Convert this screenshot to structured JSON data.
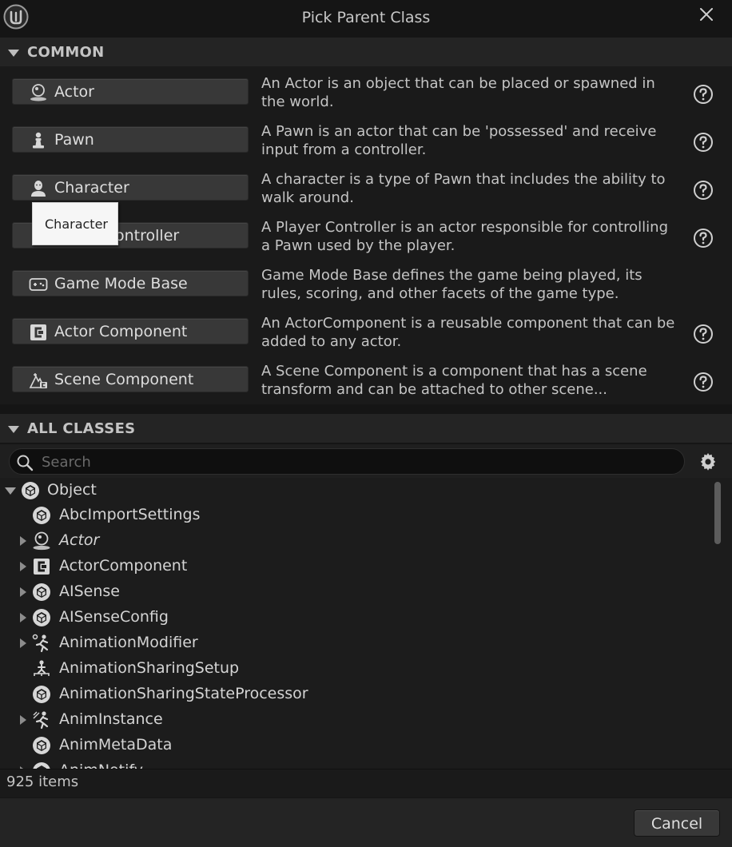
{
  "window": {
    "title": "Pick Parent Class"
  },
  "common": {
    "header": "COMMON",
    "rows": [
      {
        "label": "Actor",
        "icon": "actor-icon",
        "description": "An Actor is an object that can be placed or spawned in the world.",
        "has_help": true
      },
      {
        "label": "Pawn",
        "icon": "pawn-icon",
        "description": "A Pawn is an actor that can be 'possessed' and receive input from a controller.",
        "has_help": true
      },
      {
        "label": "Character",
        "icon": "character-icon",
        "description": "A character is a type of Pawn that includes the ability to walk around.",
        "has_help": true
      },
      {
        "label": "Player Controller",
        "visible_label": "ontroller",
        "icon": "player-controller-icon",
        "description": "A Player Controller is an actor responsible for controlling a Pawn used by the player.",
        "has_help": true
      },
      {
        "label": "Game Mode Base",
        "icon": "gamepad-icon",
        "description": "Game Mode Base defines the game being played, its rules, scoring, and other facets of the game type.",
        "has_help": false
      },
      {
        "label": "Actor Component",
        "icon": "component-icon",
        "description": "An ActorComponent is a reusable component that can be added to any actor.",
        "has_help": true
      },
      {
        "label": "Scene Component",
        "icon": "scene-component-icon",
        "description": "A Scene Component is a component that has a scene transform and can be attached to other scene...",
        "has_help": true
      }
    ],
    "tooltip": "Character"
  },
  "all_classes": {
    "header": "ALL CLASSES",
    "search_placeholder": "Search",
    "tree": [
      {
        "label": "Object",
        "icon": "object-icon",
        "expander": "open",
        "italic": false
      },
      {
        "label": "AbcImportSettings",
        "icon": "object-icon",
        "expander": "none",
        "italic": false
      },
      {
        "label": "Actor",
        "icon": "actor-icon",
        "expander": "closed",
        "italic": true
      },
      {
        "label": "ActorComponent",
        "icon": "component-icon",
        "expander": "closed",
        "italic": false
      },
      {
        "label": "AISense",
        "icon": "object-icon",
        "expander": "closed",
        "italic": false
      },
      {
        "label": "AISenseConfig",
        "icon": "object-icon",
        "expander": "closed",
        "italic": false
      },
      {
        "label": "AnimationModifier",
        "icon": "animation-modifier-icon",
        "expander": "closed",
        "italic": false
      },
      {
        "label": "AnimationSharingSetup",
        "icon": "animation-sharing-icon",
        "expander": "none",
        "italic": false
      },
      {
        "label": "AnimationSharingStateProcessor",
        "icon": "object-icon",
        "expander": "none",
        "italic": false
      },
      {
        "label": "AnimInstance",
        "icon": "anim-instance-icon",
        "expander": "closed",
        "italic": false
      },
      {
        "label": "AnimMetaData",
        "icon": "object-icon",
        "expander": "none",
        "italic": false
      },
      {
        "label": "AnimNotify",
        "icon": "object-icon",
        "expander": "closed",
        "italic": false
      }
    ],
    "item_count": "925 items"
  },
  "footer": {
    "cancel_label": "Cancel"
  },
  "colors": {
    "background": "#151515",
    "button": "#383838",
    "text": "#c4c4c4",
    "tooltip_bg": "#f6f6f6"
  }
}
